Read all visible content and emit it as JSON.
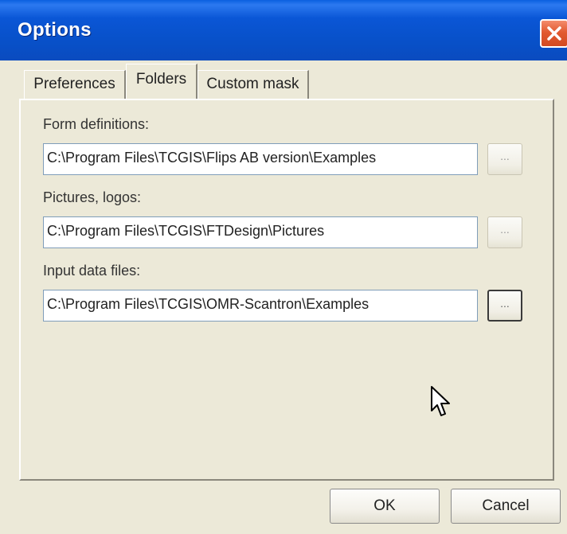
{
  "window": {
    "title": "Options"
  },
  "tabs": [
    {
      "label": "Preferences",
      "active": false
    },
    {
      "label": "Folders",
      "active": true
    },
    {
      "label": "Custom mask",
      "active": false
    }
  ],
  "folders": {
    "form_definitions": {
      "label": "Form definitions:",
      "value": "C:\\Program Files\\TCGIS\\Flips AB version\\Examples",
      "browse_label": "..."
    },
    "pictures_logos": {
      "label": "Pictures, logos:",
      "value": "C:\\Program Files\\TCGIS\\FTDesign\\Pictures",
      "browse_label": "..."
    },
    "input_data_files": {
      "label": "Input data files:",
      "value": "C:\\Program Files\\TCGIS\\OMR-Scantron\\Examples",
      "browse_label": "..."
    }
  },
  "buttons": {
    "ok_label": "OK",
    "cancel_label": "Cancel"
  },
  "colors": {
    "titlebar": "#0a56d6",
    "close_button": "#e25a30",
    "dialog_background": "#ece9d8"
  }
}
